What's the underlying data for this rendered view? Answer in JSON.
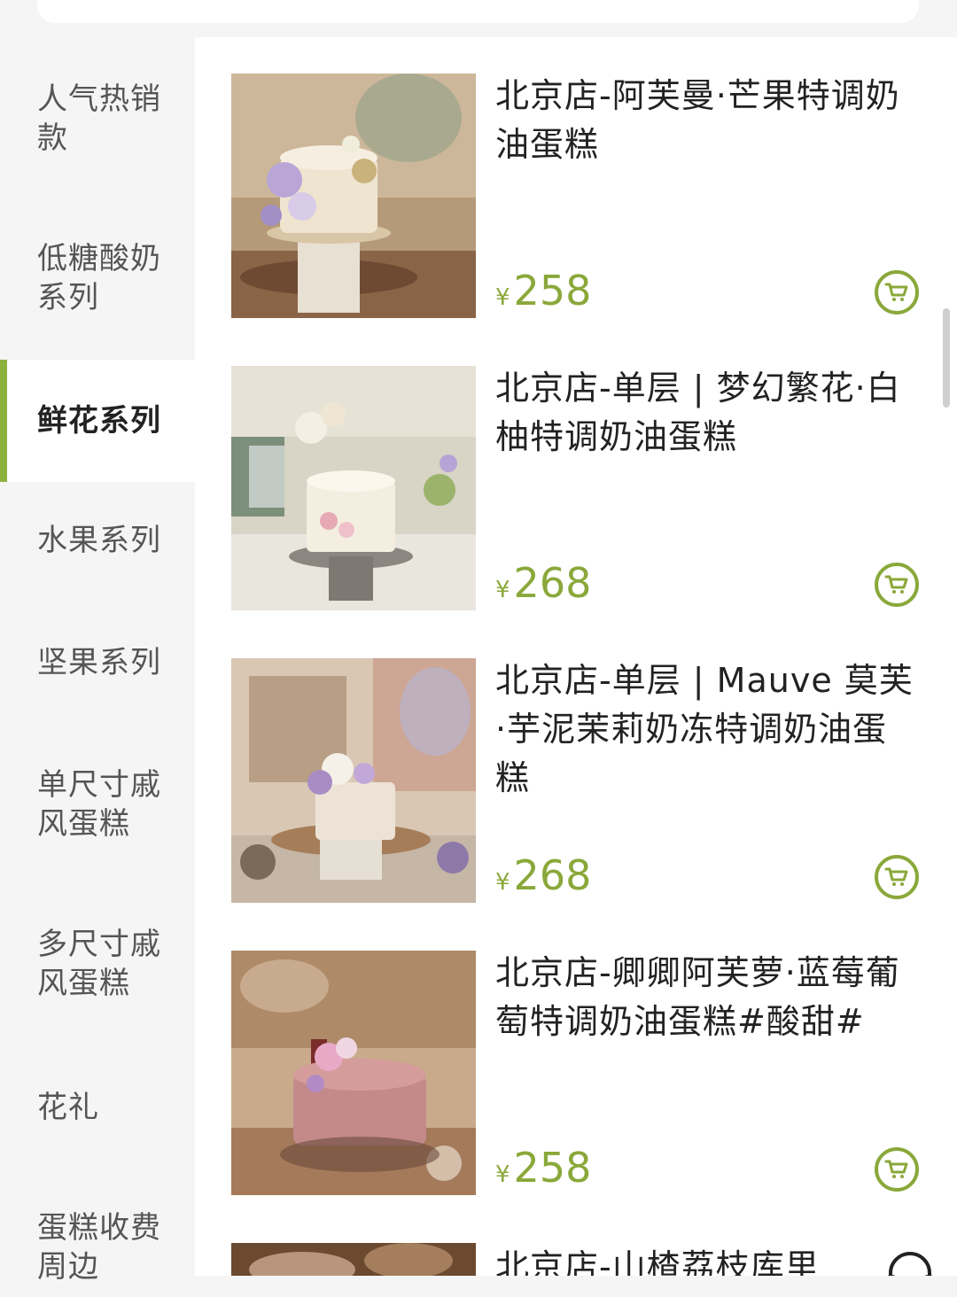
{
  "categories": [
    {
      "label": "人气热销款",
      "active": false
    },
    {
      "label": "低糖酸奶系列",
      "active": false
    },
    {
      "label": "鲜花系列",
      "active": true
    },
    {
      "label": "水果系列",
      "active": false
    },
    {
      "label": "坚果系列",
      "active": false
    },
    {
      "label": "单尺寸戚风蛋糕",
      "active": false
    },
    {
      "label": "多尺寸戚风蛋糕",
      "active": false
    },
    {
      "label": "花礼",
      "active": false
    },
    {
      "label": "蛋糕收费周边",
      "active": false
    }
  ],
  "products": [
    {
      "title": "北京店-阿芙曼·芒果特调奶油蛋糕",
      "currency": "¥",
      "price": "258"
    },
    {
      "title": "北京店-单层 | 梦幻繁花·白柚特调奶油蛋糕",
      "currency": "¥",
      "price": "268"
    },
    {
      "title": "北京店-单层 | Mauve 莫芙·芋泥茉莉奶冻特调奶油蛋糕",
      "currency": "¥",
      "price": "268"
    },
    {
      "title": "北京店-卿卿阿芙萝·蓝莓葡萄特调奶油蛋糕#酸甜#",
      "currency": "¥",
      "price": "258"
    },
    {
      "title": "北京店-山楂荔枝库里",
      "currency": "",
      "price": ""
    }
  ],
  "icons": {
    "cart": "cart-icon",
    "support": "headset-icon"
  },
  "colors": {
    "accent": "#8aa83a",
    "sidebar_bg": "#f5f5f5",
    "active_bar": "#8db13f"
  }
}
